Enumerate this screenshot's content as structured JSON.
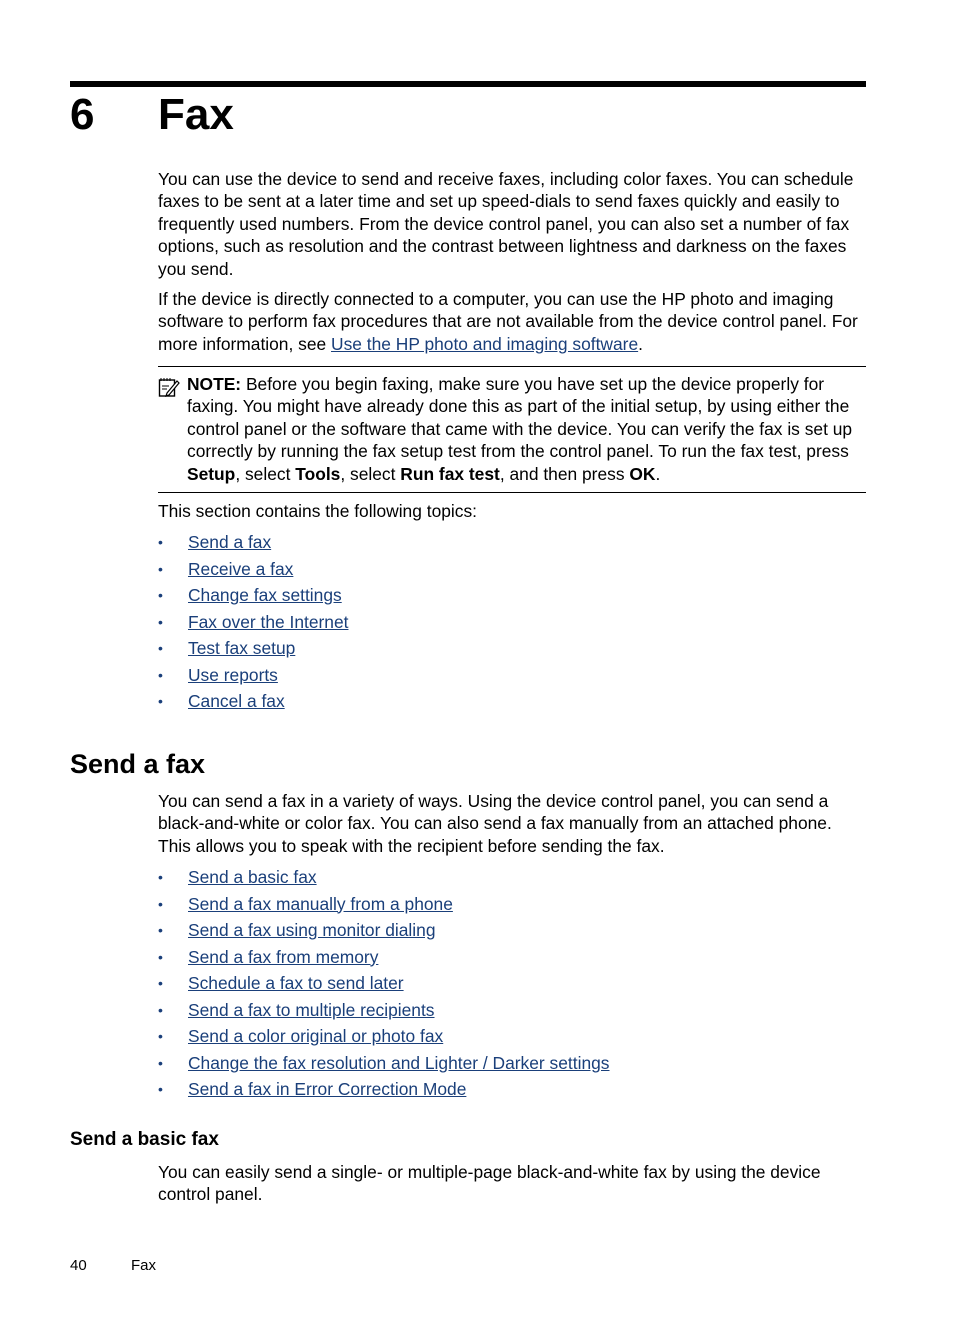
{
  "chapter": {
    "number": "6",
    "title": "Fax"
  },
  "intro": {
    "paragraph1": "You can use the device to send and receive faxes, including color faxes. You can schedule faxes to be sent at a later time and set up speed-dials to send faxes quickly and easily to frequently used numbers. From the device control panel, you can also set a number of fax options, such as resolution and the contrast between lightness and darkness on the faxes you send.",
    "paragraph2_before": "If the device is directly connected to a computer, you can use the HP photo and imaging software to perform fax procedures that are not available from the device control panel. For more information, see ",
    "paragraph2_link": "Use the HP photo and imaging software",
    "paragraph2_after": "."
  },
  "note": {
    "label": "NOTE:",
    "text1": "  Before you begin faxing, make sure you have set up the device properly for faxing. You might have already done this as part of the initial setup, by using either the control panel or the software that came with the device. You can verify the fax is set up correctly by running the fax setup test from the control panel. To run the fax test, press ",
    "bold1": "Setup",
    "text2": ", select ",
    "bold2": "Tools",
    "text3": ", select ",
    "bold3": "Run fax test",
    "text4": ", and then press ",
    "bold4": "OK",
    "text5": "."
  },
  "topics_intro": "This section contains the following topics:",
  "topics": [
    {
      "bullet": "•",
      "label": "Send a fax"
    },
    {
      "bullet": "•",
      "label": "Receive a fax"
    },
    {
      "bullet": "•",
      "label": "Change fax settings"
    },
    {
      "bullet": "•",
      "label": "Fax over the Internet"
    },
    {
      "bullet": "•",
      "label": "Test fax setup"
    },
    {
      "bullet": "•",
      "label": "Use reports"
    },
    {
      "bullet": "•",
      "label": "Cancel a fax"
    }
  ],
  "send_section": {
    "heading": "Send a fax",
    "paragraph": "You can send a fax in a variety of ways. Using the device control panel, you can send a black-and-white or color fax. You can also send a fax manually from an attached phone. This allows you to speak with the recipient before sending the fax.",
    "links": [
      {
        "bullet": "•",
        "label": "Send a basic fax"
      },
      {
        "bullet": "•",
        "label": "Send a fax manually from a phone"
      },
      {
        "bullet": "•",
        "label": "Send a fax using monitor dialing"
      },
      {
        "bullet": "•",
        "label": "Send a fax from memory"
      },
      {
        "bullet": "•",
        "label": "Schedule a fax to send later"
      },
      {
        "bullet": "•",
        "label": "Send a fax to multiple recipients"
      },
      {
        "bullet": "•",
        "label": "Send a color original or photo fax"
      },
      {
        "bullet": "•",
        "label": "Change the fax resolution and Lighter / Darker settings"
      },
      {
        "bullet": "•",
        "label": "Send a fax in Error Correction Mode"
      }
    ]
  },
  "basic_section": {
    "heading": "Send a basic fax",
    "paragraph": "You can easily send a single- or multiple-page black-and-white fax by using the device control panel."
  },
  "footer": {
    "page_number": "40",
    "section": "Fax"
  },
  "colors": {
    "link": "#1a3f7a",
    "text": "#000000"
  }
}
